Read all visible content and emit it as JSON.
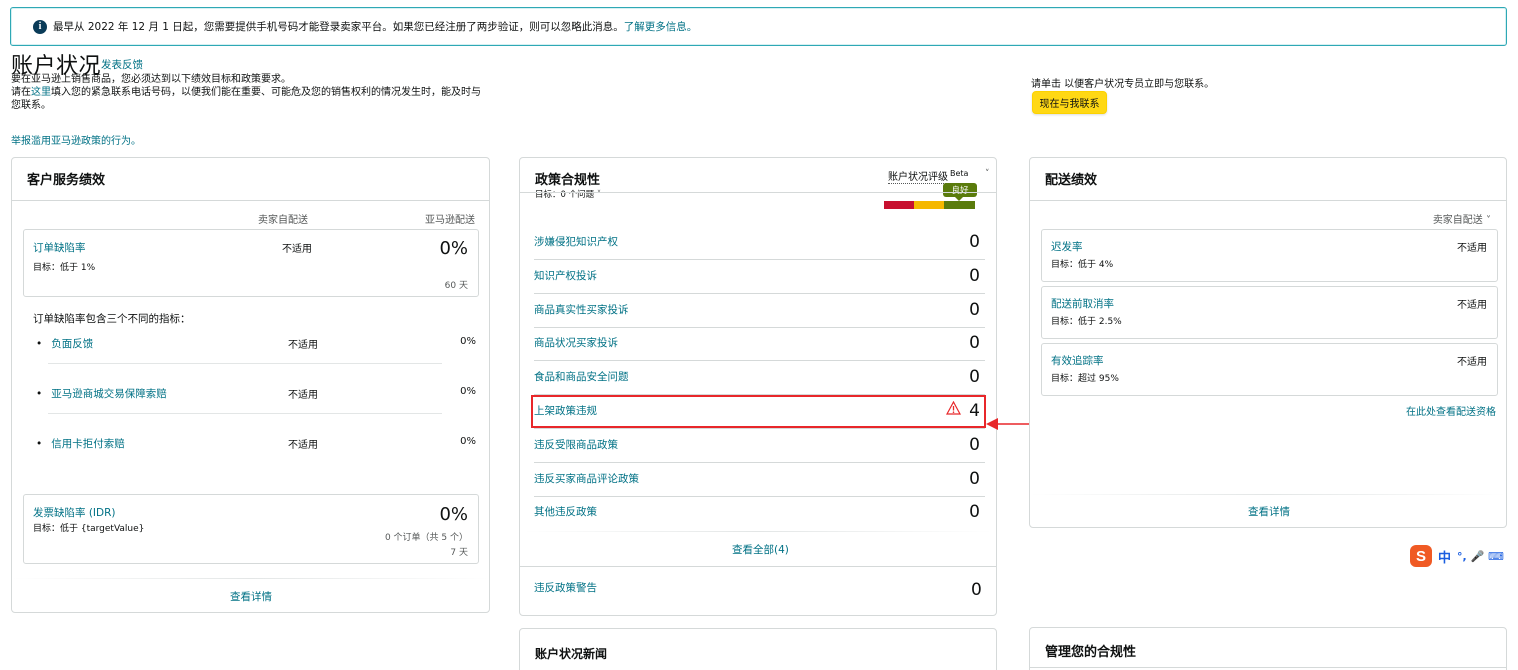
{
  "alert": {
    "text": "最早从 2022 年 12 月 1 日起，您需要提供手机号码才能登录卖家平台。如果您已经注册了两步验证，则可以忽略此消息。",
    "link": "了解更多信息。",
    "icon": "info-icon"
  },
  "header": {
    "title": "账户状况",
    "feedback": "发表反馈",
    "intro_line1": "要在亚马逊上销售商品，您必须达到以下绩效目标和政策要求。",
    "intro_line2_prefix": "请在",
    "intro_line2_link": "这里",
    "intro_line2_suffix": "填入您的紧急联系电话号码，以便我们能在重要、可能危及您的销售权利的情况发生时，能及时与您联系。",
    "report": "举报滥用亚马逊政策的行为。",
    "contact_text": "请单击 以便客户状况专员立即与您联系。",
    "contact_button": "现在与我联系"
  },
  "customer_service": {
    "title": "客户服务绩效",
    "col_seller": "卖家自配送",
    "col_amazon": "亚马逊配送",
    "odr": {
      "label": "订单缺陷率",
      "target": "目标：低于 1%",
      "seller": "不适用",
      "amazon": "0%",
      "period": "60 天"
    },
    "odr_desc": "订单缺陷率包含三个不同的指标：",
    "sub_metrics": [
      {
        "label": "负面反馈",
        "seller": "不适用",
        "amazon": "0%"
      },
      {
        "label": "亚马逊商城交易保障索赔",
        "seller": "不适用",
        "amazon": "0%"
      },
      {
        "label": "信用卡拒付索赔",
        "seller": "不适用",
        "amazon": "0%"
      }
    ],
    "idr": {
      "label": "发票缺陷率 (IDR)",
      "target": "目标：低于 {targetValue}",
      "value": "0%",
      "orders": "0 个订单（共 5 个）",
      "period": "7 天"
    },
    "view_details": "查看详情"
  },
  "policy": {
    "title": "政策合规性",
    "target": "目标：0 个问题",
    "rating_label": "账户状况评级",
    "beta": "Beta",
    "badge": "良好",
    "rating_level": 1.0,
    "rows": [
      {
        "label": "涉嫌侵犯知识产权",
        "value": "0"
      },
      {
        "label": "知识产权投诉",
        "value": "0"
      },
      {
        "label": "商品真实性买家投诉",
        "value": "0"
      },
      {
        "label": "商品状况买家投诉",
        "value": "0"
      },
      {
        "label": "食品和商品安全问题",
        "value": "0"
      },
      {
        "label": "上架政策违规",
        "value": "4"
      },
      {
        "label": "违反受限商品政策",
        "value": "0"
      },
      {
        "label": "违反买家商品评论政策",
        "value": "0"
      },
      {
        "label": "其他违反政策",
        "value": "0"
      }
    ],
    "view_all": "查看全部(4)",
    "warnings": {
      "label": "违反政策警告",
      "value": "0"
    },
    "colors": {
      "red": "#c7102f",
      "yellow": "#f5b800",
      "green": "#5a7b0c"
    }
  },
  "delivery": {
    "title": "配送绩效",
    "filter": "卖家自配送",
    "metrics": [
      {
        "label": "迟发率",
        "target": "目标：低于 4%",
        "value": "不适用"
      },
      {
        "label": "配送前取消率",
        "target": "目标：低于 2.5%",
        "value": "不适用"
      },
      {
        "label": "有效追踪率",
        "target": "目标：超过 95%",
        "value": "不适用"
      }
    ],
    "eligibility": "在此处查看配送资格",
    "view_details": "查看详情"
  },
  "news": {
    "title": "账户状况新闻"
  },
  "manage": {
    "title": "管理您的合规性"
  },
  "ime": {
    "logo": "S",
    "label": "中",
    "extras": "°, 🎤 ⌨"
  }
}
